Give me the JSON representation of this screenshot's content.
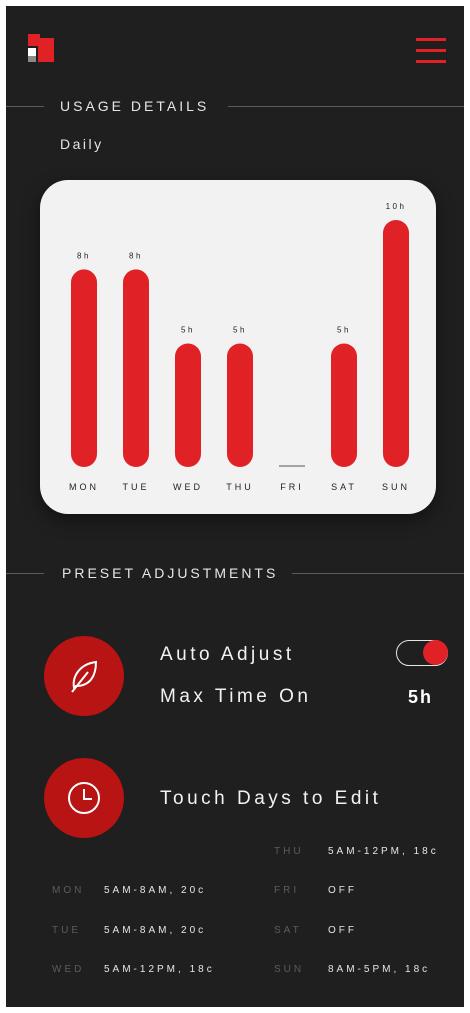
{
  "header": {
    "logo_icon": "brand-logo",
    "menu_icon": "hamburger-menu-icon",
    "accent_color": "#e02126"
  },
  "usage": {
    "section_title": "USAGE DETAILS",
    "period_label": "Daily"
  },
  "chart_data": {
    "type": "bar",
    "categories": [
      "MON",
      "TUE",
      "WED",
      "THU",
      "FRI",
      "SAT",
      "SUN"
    ],
    "values": [
      8,
      8,
      5,
      5,
      0,
      5,
      10
    ],
    "value_labels": [
      "8h",
      "8h",
      "5h",
      "5h",
      "",
      "5h",
      "10h"
    ],
    "bar_color": "#e02126",
    "background": "#f2f2f2",
    "ylim": [
      0,
      10
    ],
    "grid": false
  },
  "preset": {
    "section_title": "PRESET ADJUSTMENTS",
    "auto_adjust_label": "Auto Adjust",
    "auto_adjust_on": true,
    "max_time_label": "Max Time On",
    "max_time_value": "5h",
    "leaf_icon": "leaf-icon",
    "clock_icon": "clock-icon",
    "touch_days_label": "Touch Days to Edit"
  },
  "schedule": {
    "left": [
      {
        "day": "MON",
        "time": "5AM-8AM, 20c"
      },
      {
        "day": "TUE",
        "time": "5AM-8AM, 20c"
      },
      {
        "day": "WED",
        "time": "5AM-12PM, 18c"
      }
    ],
    "right": [
      {
        "day": "THU",
        "time": "5AM-12PM, 18c"
      },
      {
        "day": "FRI",
        "time": "OFF"
      },
      {
        "day": "SAT",
        "time": "OFF"
      },
      {
        "day": "SUN",
        "time": "8AM-5PM, 18c"
      }
    ]
  }
}
